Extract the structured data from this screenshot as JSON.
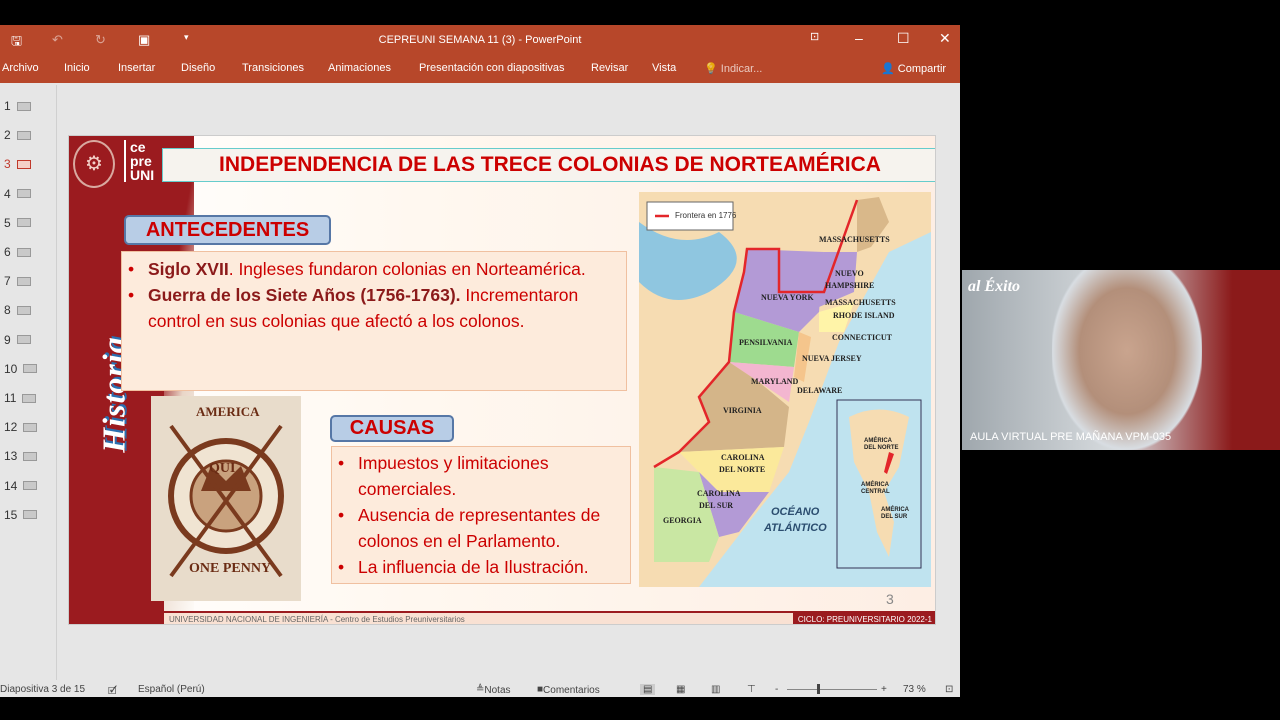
{
  "window": {
    "title": "CEPREUNI SEMANA 11 (3) - PowerPoint"
  },
  "ribbon": {
    "tabs": [
      "Archivo",
      "Inicio",
      "Insertar",
      "Diseño",
      "Transiciones",
      "Animaciones",
      "Presentación con diapositivas",
      "Revisar",
      "Vista"
    ],
    "tell_me": "Indicar...",
    "share": "Compartir"
  },
  "thumbnails": [
    "1",
    "2",
    "3",
    "4",
    "5",
    "6",
    "7",
    "8",
    "9",
    "10",
    "11",
    "12",
    "13",
    "14",
    "15"
  ],
  "slide": {
    "logo_text": [
      "ce",
      "pre",
      "UNI"
    ],
    "vertical_label": "Historia",
    "title": "INDEPENDENCIA DE LAS TRECE COLONIAS DE NORTEAMÉRICA",
    "antecedentes": {
      "header": "ANTECEDENTES",
      "items": [
        {
          "bold": "Siglo XVII",
          "text": ". Ingleses fundaron colonias en Norteamérica."
        },
        {
          "bold": "Guerra de los Siete Años (1756-1763).",
          "text": " Incrementaron control en sus colonias que afectó a los colonos."
        }
      ]
    },
    "causas": {
      "header": "CAUSAS",
      "items": [
        "Impuestos y limitaciones comerciales.",
        "Ausencia de representantes de colonos en el Parlamento.",
        "La influencia de la Ilustración."
      ]
    },
    "stamp_text": [
      "AMERICA",
      "QUI",
      "ONE PENNY"
    ],
    "map": {
      "legend": "Frontera en 1776",
      "labels": [
        "MASSACHUSETTS",
        "NUEVO",
        "HAMPSHIRE",
        "NUEVA YORK",
        "MASSACHUSETTS",
        "RHODE ISLAND",
        "CONNECTICUT",
        "PENSILVANIA",
        "NUEVA JERSEY",
        "MARYLAND",
        "DELAWARE",
        "VIRGINIA",
        "CAROLINA",
        "DEL NORTE",
        "CAROLINA",
        "DEL SUR",
        "GEORGIA",
        "OCÉANO",
        "ATLÁNTICO"
      ],
      "inset": [
        "AMÉRICA",
        "DEL NORTE",
        "AMÉRICA",
        "CENTRAL",
        "AMÉRICA",
        "DEL SUR"
      ]
    },
    "page_number": "3",
    "footer_left": "UNIVERSIDAD NACIONAL DE INGENIERÍA - Centro de Estudios Preuniversitarios",
    "footer_right": "CICLO: PREUNIVERSITARIO 2022-1"
  },
  "status": {
    "slide": "Diapositiva 3 de 15",
    "language": "Español (Perú)",
    "notes": "Notas",
    "comments": "Comentarios",
    "zoom": "73 %"
  },
  "webcam": {
    "label": "AULA VIRTUAL PRE MAÑANA VPM-035",
    "banner": "al Éxito"
  }
}
